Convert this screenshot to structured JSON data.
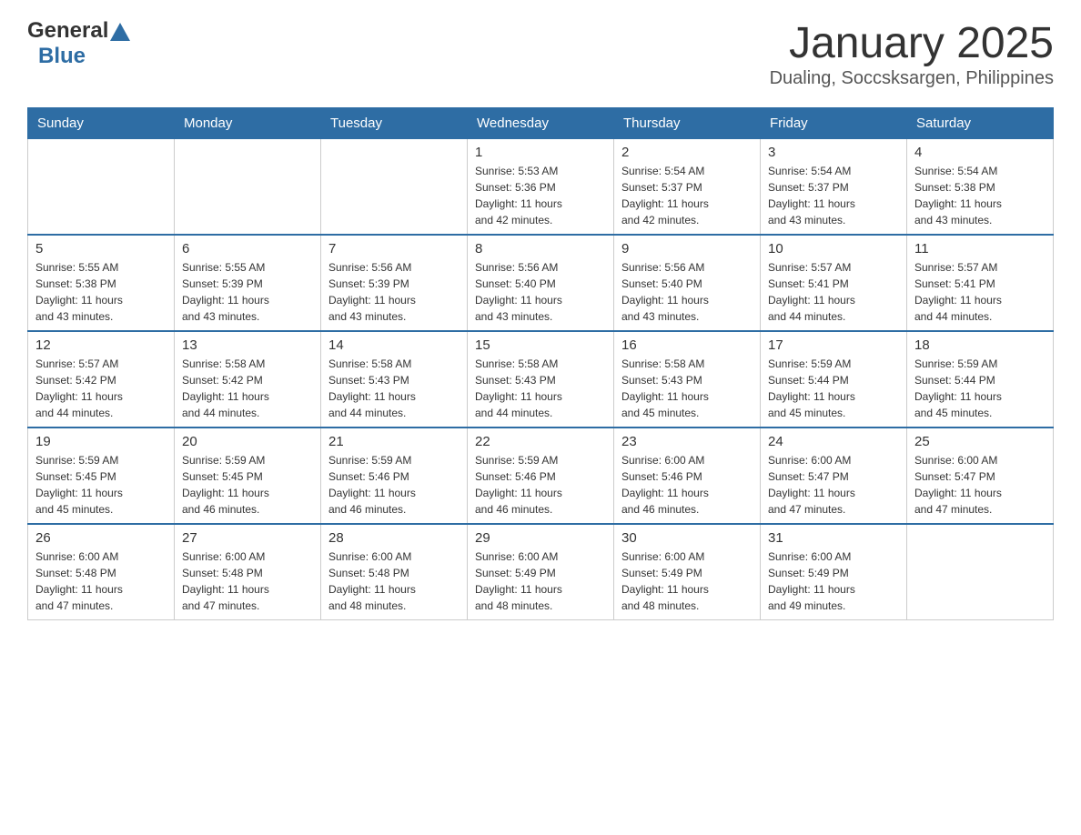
{
  "header": {
    "logo_general": "General",
    "logo_blue": "Blue",
    "title": "January 2025",
    "subtitle": "Dualing, Soccsksargen, Philippines"
  },
  "calendar": {
    "days": [
      "Sunday",
      "Monday",
      "Tuesday",
      "Wednesday",
      "Thursday",
      "Friday",
      "Saturday"
    ],
    "weeks": [
      [
        {
          "day": "",
          "info": ""
        },
        {
          "day": "",
          "info": ""
        },
        {
          "day": "",
          "info": ""
        },
        {
          "day": "1",
          "info": "Sunrise: 5:53 AM\nSunset: 5:36 PM\nDaylight: 11 hours\nand 42 minutes."
        },
        {
          "day": "2",
          "info": "Sunrise: 5:54 AM\nSunset: 5:37 PM\nDaylight: 11 hours\nand 42 minutes."
        },
        {
          "day": "3",
          "info": "Sunrise: 5:54 AM\nSunset: 5:37 PM\nDaylight: 11 hours\nand 43 minutes."
        },
        {
          "day": "4",
          "info": "Sunrise: 5:54 AM\nSunset: 5:38 PM\nDaylight: 11 hours\nand 43 minutes."
        }
      ],
      [
        {
          "day": "5",
          "info": "Sunrise: 5:55 AM\nSunset: 5:38 PM\nDaylight: 11 hours\nand 43 minutes."
        },
        {
          "day": "6",
          "info": "Sunrise: 5:55 AM\nSunset: 5:39 PM\nDaylight: 11 hours\nand 43 minutes."
        },
        {
          "day": "7",
          "info": "Sunrise: 5:56 AM\nSunset: 5:39 PM\nDaylight: 11 hours\nand 43 minutes."
        },
        {
          "day": "8",
          "info": "Sunrise: 5:56 AM\nSunset: 5:40 PM\nDaylight: 11 hours\nand 43 minutes."
        },
        {
          "day": "9",
          "info": "Sunrise: 5:56 AM\nSunset: 5:40 PM\nDaylight: 11 hours\nand 43 minutes."
        },
        {
          "day": "10",
          "info": "Sunrise: 5:57 AM\nSunset: 5:41 PM\nDaylight: 11 hours\nand 44 minutes."
        },
        {
          "day": "11",
          "info": "Sunrise: 5:57 AM\nSunset: 5:41 PM\nDaylight: 11 hours\nand 44 minutes."
        }
      ],
      [
        {
          "day": "12",
          "info": "Sunrise: 5:57 AM\nSunset: 5:42 PM\nDaylight: 11 hours\nand 44 minutes."
        },
        {
          "day": "13",
          "info": "Sunrise: 5:58 AM\nSunset: 5:42 PM\nDaylight: 11 hours\nand 44 minutes."
        },
        {
          "day": "14",
          "info": "Sunrise: 5:58 AM\nSunset: 5:43 PM\nDaylight: 11 hours\nand 44 minutes."
        },
        {
          "day": "15",
          "info": "Sunrise: 5:58 AM\nSunset: 5:43 PM\nDaylight: 11 hours\nand 44 minutes."
        },
        {
          "day": "16",
          "info": "Sunrise: 5:58 AM\nSunset: 5:43 PM\nDaylight: 11 hours\nand 45 minutes."
        },
        {
          "day": "17",
          "info": "Sunrise: 5:59 AM\nSunset: 5:44 PM\nDaylight: 11 hours\nand 45 minutes."
        },
        {
          "day": "18",
          "info": "Sunrise: 5:59 AM\nSunset: 5:44 PM\nDaylight: 11 hours\nand 45 minutes."
        }
      ],
      [
        {
          "day": "19",
          "info": "Sunrise: 5:59 AM\nSunset: 5:45 PM\nDaylight: 11 hours\nand 45 minutes."
        },
        {
          "day": "20",
          "info": "Sunrise: 5:59 AM\nSunset: 5:45 PM\nDaylight: 11 hours\nand 46 minutes."
        },
        {
          "day": "21",
          "info": "Sunrise: 5:59 AM\nSunset: 5:46 PM\nDaylight: 11 hours\nand 46 minutes."
        },
        {
          "day": "22",
          "info": "Sunrise: 5:59 AM\nSunset: 5:46 PM\nDaylight: 11 hours\nand 46 minutes."
        },
        {
          "day": "23",
          "info": "Sunrise: 6:00 AM\nSunset: 5:46 PM\nDaylight: 11 hours\nand 46 minutes."
        },
        {
          "day": "24",
          "info": "Sunrise: 6:00 AM\nSunset: 5:47 PM\nDaylight: 11 hours\nand 47 minutes."
        },
        {
          "day": "25",
          "info": "Sunrise: 6:00 AM\nSunset: 5:47 PM\nDaylight: 11 hours\nand 47 minutes."
        }
      ],
      [
        {
          "day": "26",
          "info": "Sunrise: 6:00 AM\nSunset: 5:48 PM\nDaylight: 11 hours\nand 47 minutes."
        },
        {
          "day": "27",
          "info": "Sunrise: 6:00 AM\nSunset: 5:48 PM\nDaylight: 11 hours\nand 47 minutes."
        },
        {
          "day": "28",
          "info": "Sunrise: 6:00 AM\nSunset: 5:48 PM\nDaylight: 11 hours\nand 48 minutes."
        },
        {
          "day": "29",
          "info": "Sunrise: 6:00 AM\nSunset: 5:49 PM\nDaylight: 11 hours\nand 48 minutes."
        },
        {
          "day": "30",
          "info": "Sunrise: 6:00 AM\nSunset: 5:49 PM\nDaylight: 11 hours\nand 48 minutes."
        },
        {
          "day": "31",
          "info": "Sunrise: 6:00 AM\nSunset: 5:49 PM\nDaylight: 11 hours\nand 49 minutes."
        },
        {
          "day": "",
          "info": ""
        }
      ]
    ]
  }
}
